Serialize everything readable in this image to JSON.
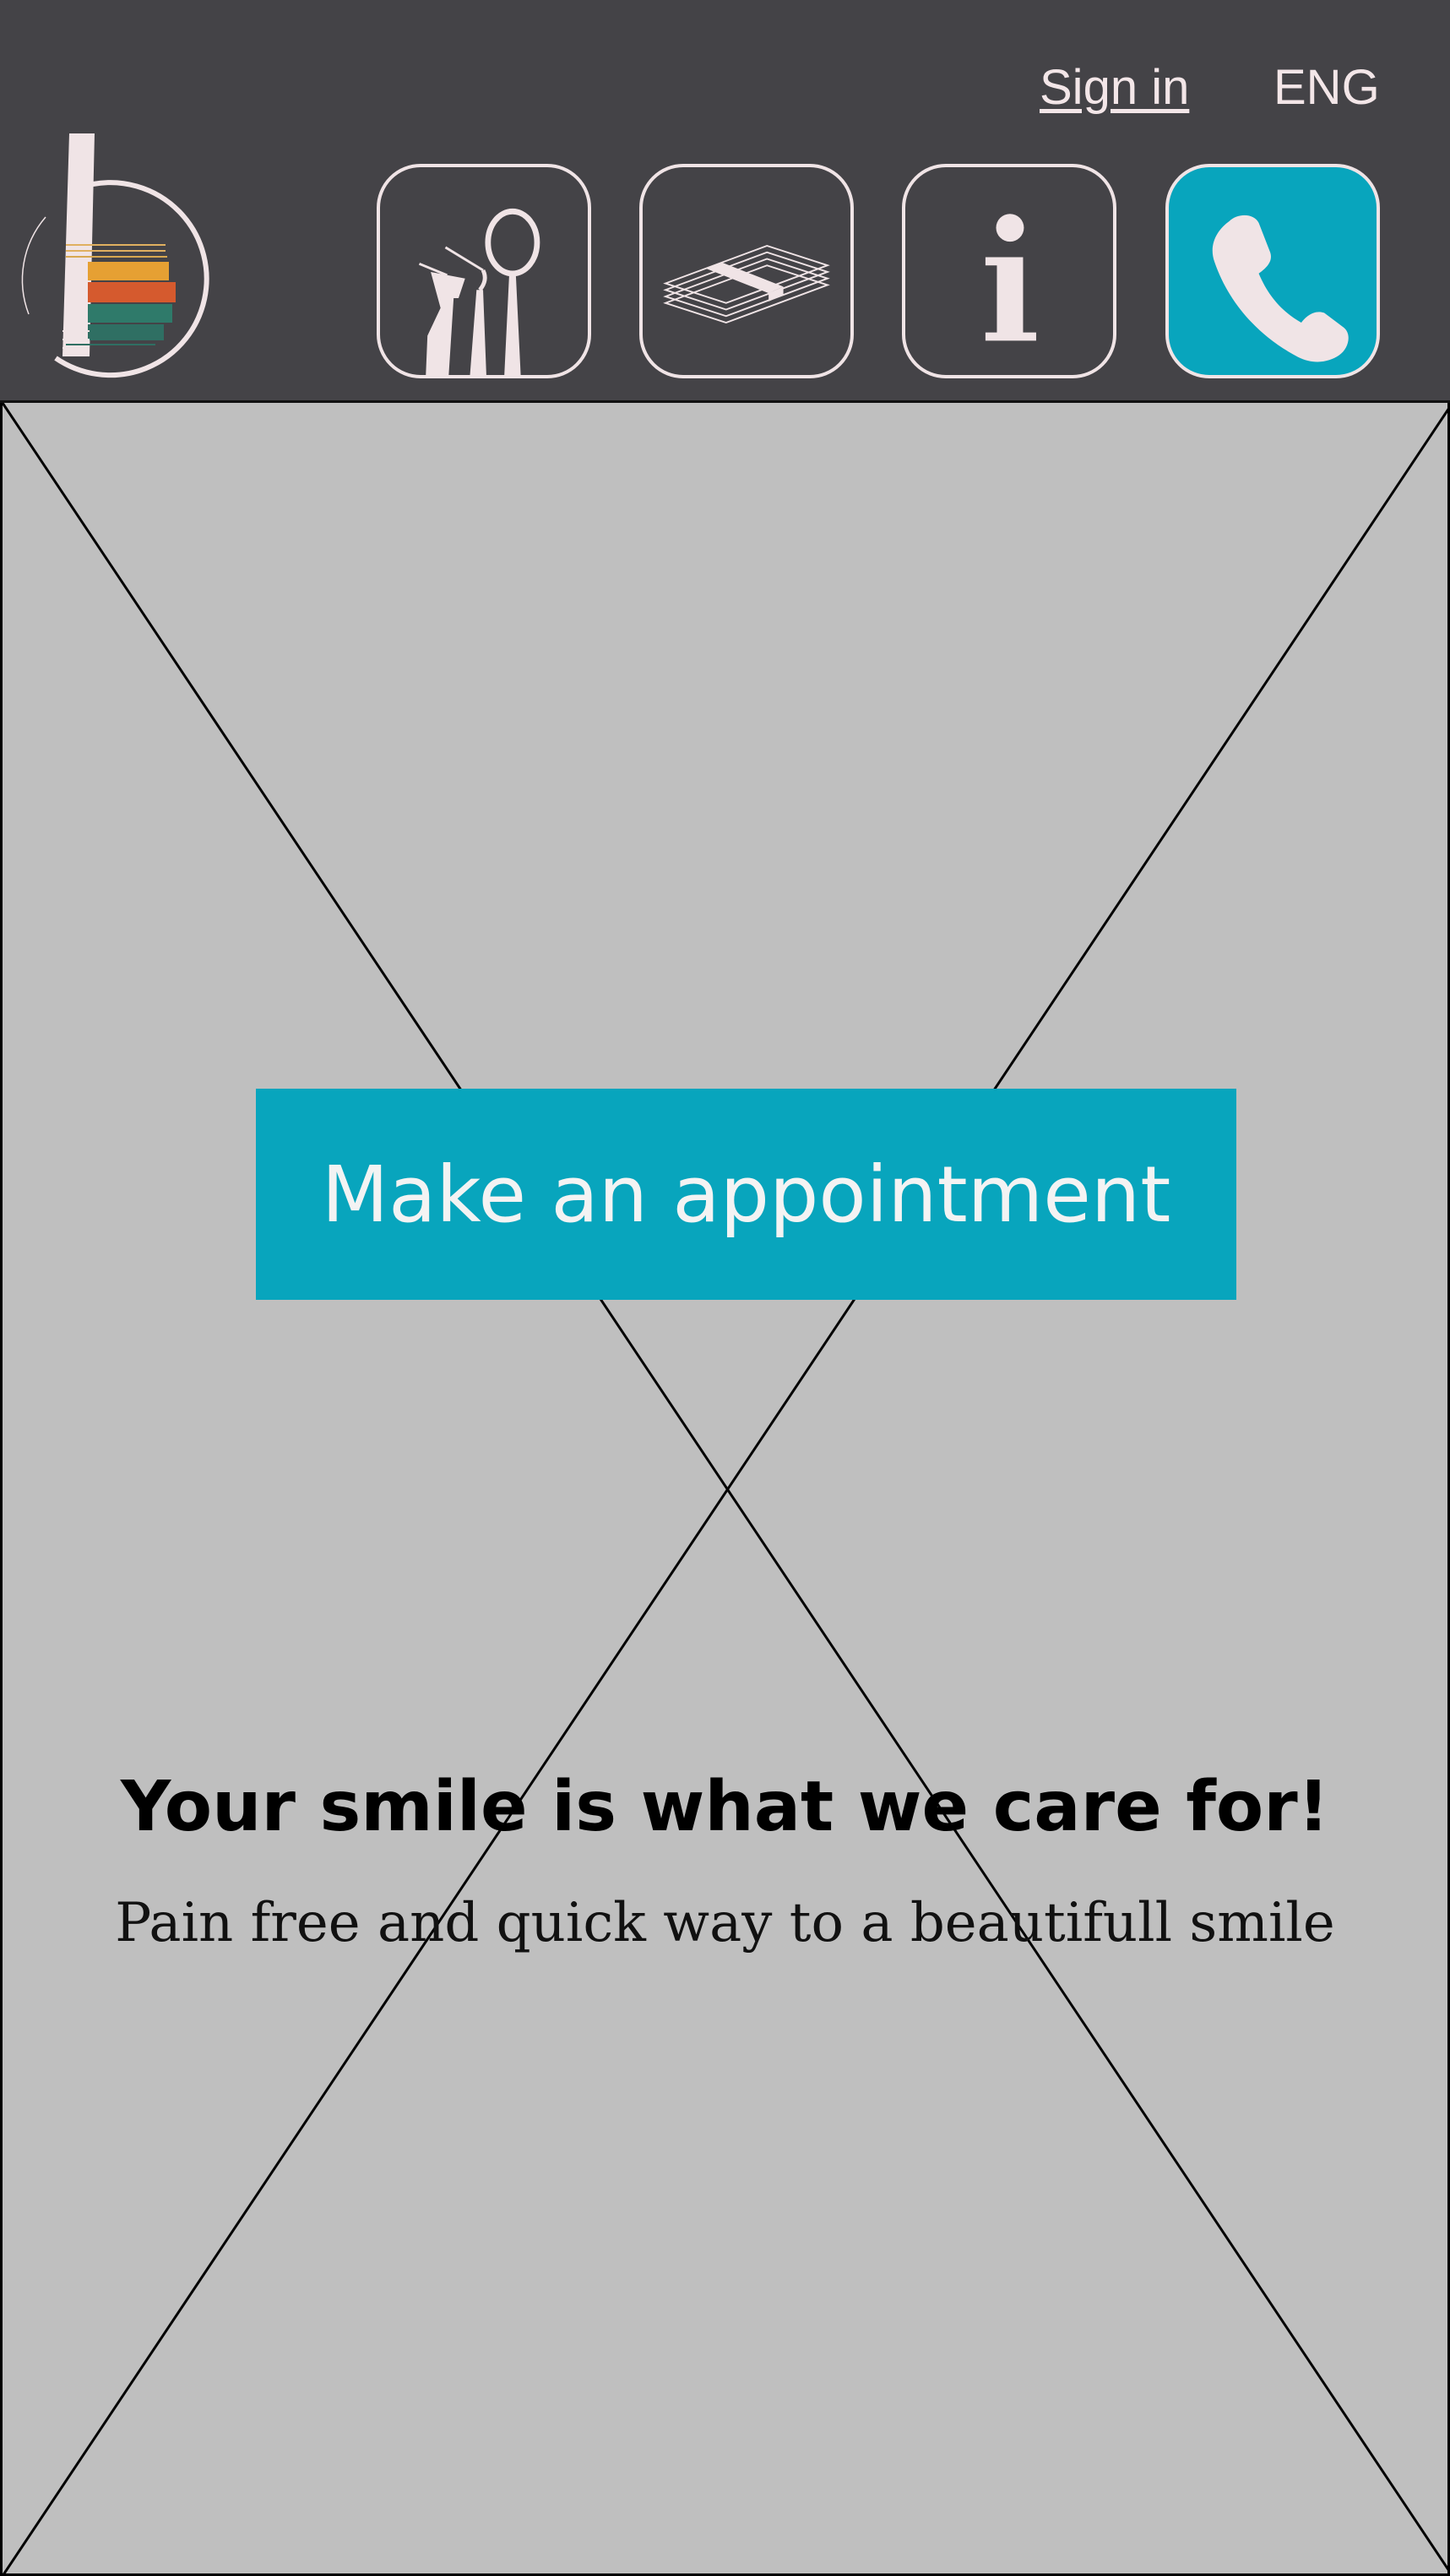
{
  "header": {
    "sign_in": "Sign in",
    "language": "ENG",
    "background": "#444347"
  },
  "nav": [
    {
      "id": "tools",
      "icon": "dental-tools-icon"
    },
    {
      "id": "price",
      "icon": "money-stack-icon"
    },
    {
      "id": "info",
      "icon": "info-icon"
    },
    {
      "id": "call",
      "icon": "phone-icon",
      "active": true
    }
  ],
  "hero": {
    "placeholder": "image-placeholder",
    "cta_label": "Make an appointment",
    "tagline": "Your smile is what we care for!",
    "subline": "Pain free and quick way to a beautifull smile"
  },
  "colors": {
    "accent": "#08a5bd",
    "icon_light": "#f0e4e6",
    "placeholder_bg": "#bfbfbf"
  }
}
